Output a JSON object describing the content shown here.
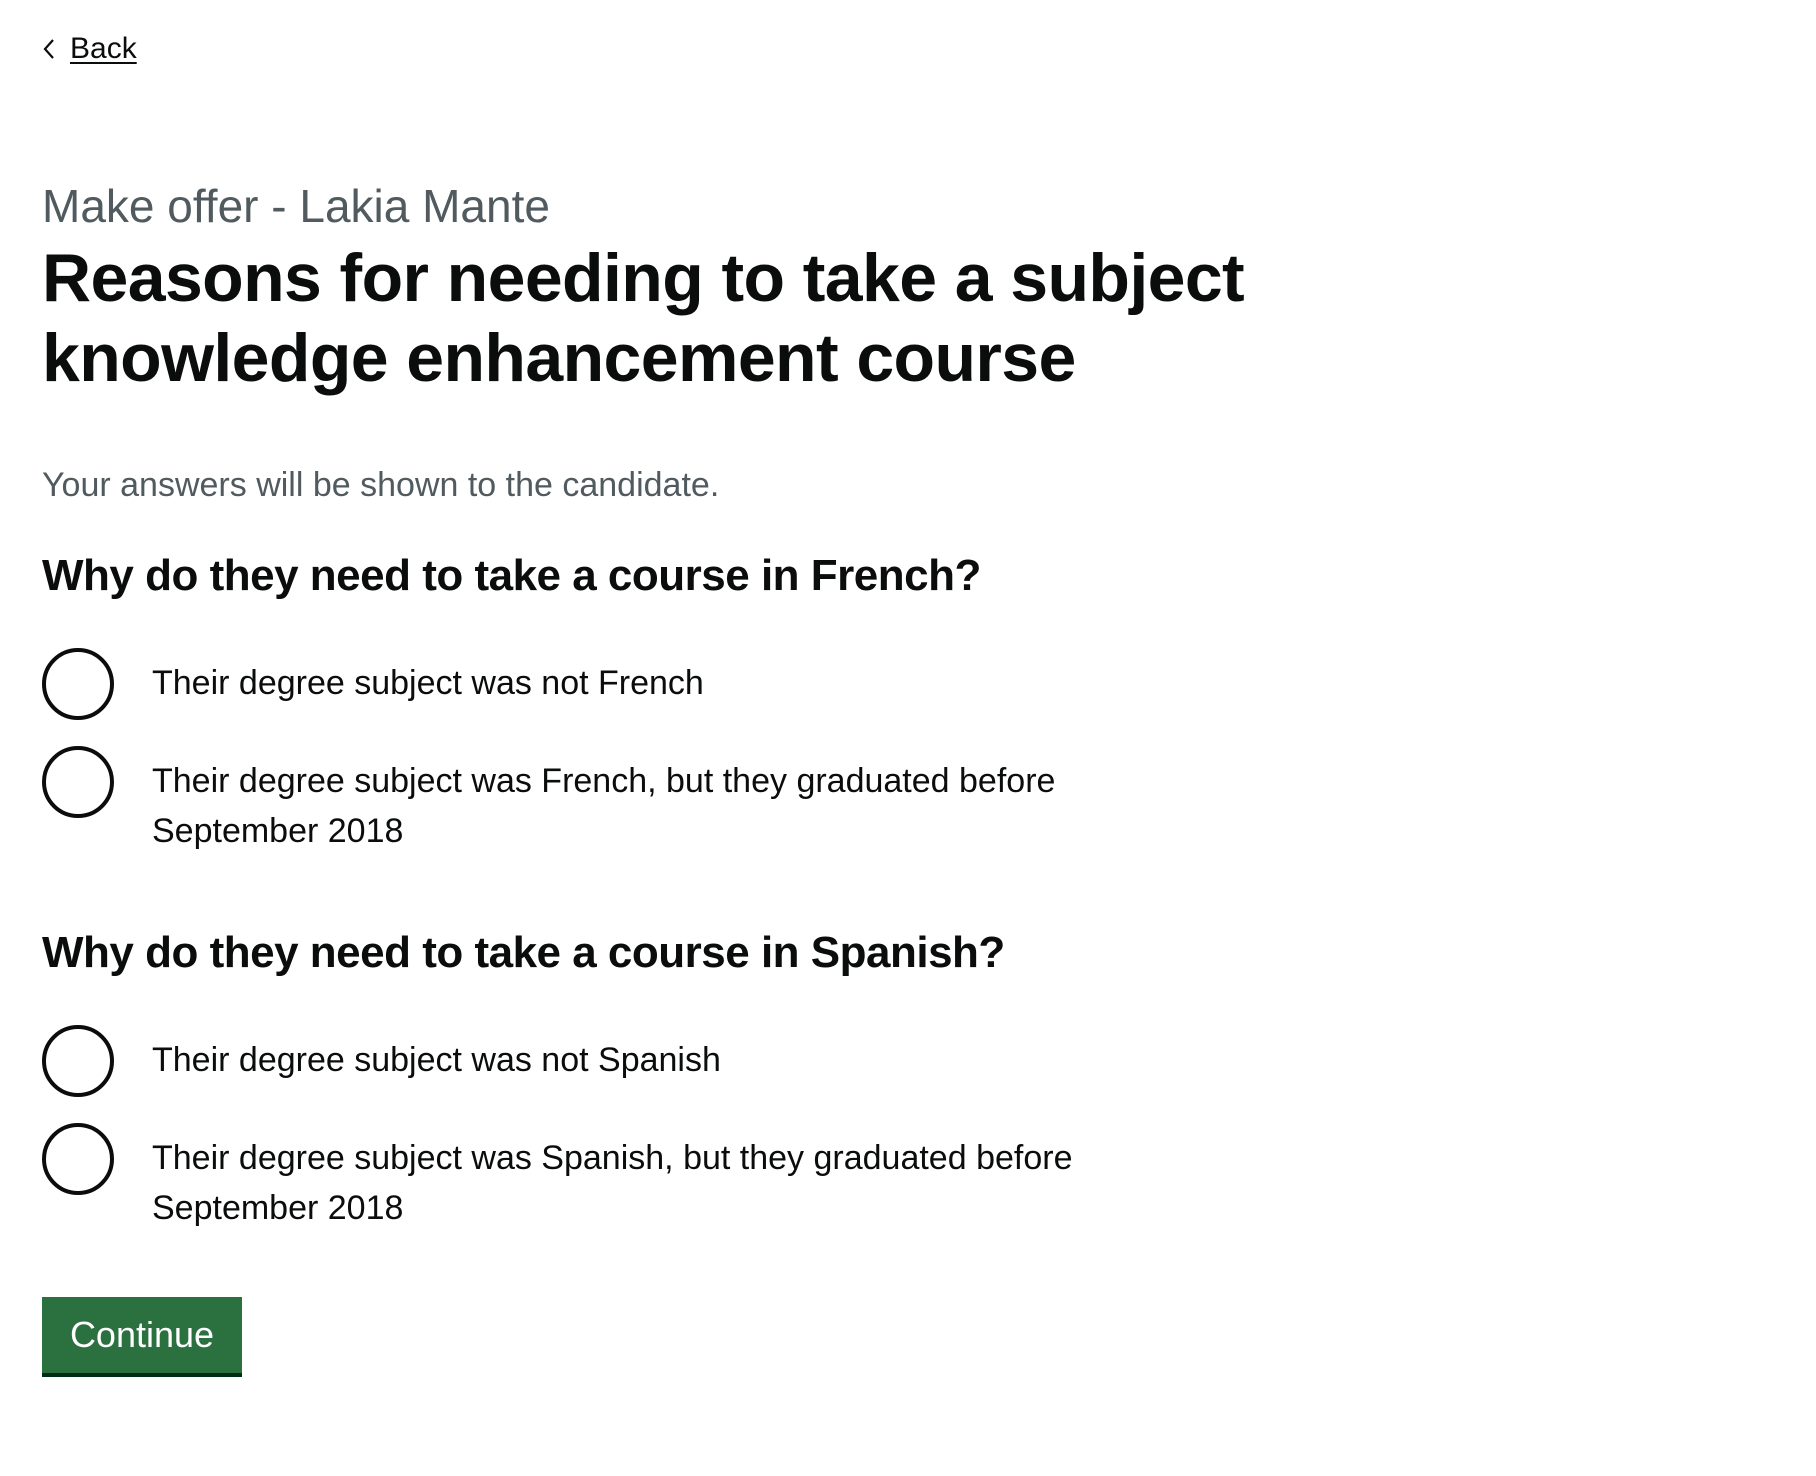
{
  "back_link": {
    "label": "Back"
  },
  "caption": "Make offer - Lakia Mante",
  "title": "Reasons for needing to take a subject knowledge enhancement course",
  "hint": "Your answers will be shown to the candidate.",
  "questions": [
    {
      "heading": "Why do they need to take a course in French?",
      "options": [
        {
          "label": "Their degree subject was not French",
          "selected": false
        },
        {
          "label": "Their degree subject was French, but they graduated before September 2018",
          "selected": false
        }
      ]
    },
    {
      "heading": "Why do they need to take a course in Spanish?",
      "options": [
        {
          "label": "Their degree subject was not Spanish",
          "selected": false
        },
        {
          "label": "Their degree subject was Spanish, but they graduated before September 2018",
          "selected": false
        }
      ]
    }
  ],
  "continue_button": {
    "label": "Continue",
    "color": "#2b7140"
  },
  "colors": {
    "text": "#0b0c0c",
    "secondary_text": "#505a5f",
    "button_shadow": "#002d18"
  },
  "icons": {
    "back": "chevron-left-icon"
  }
}
